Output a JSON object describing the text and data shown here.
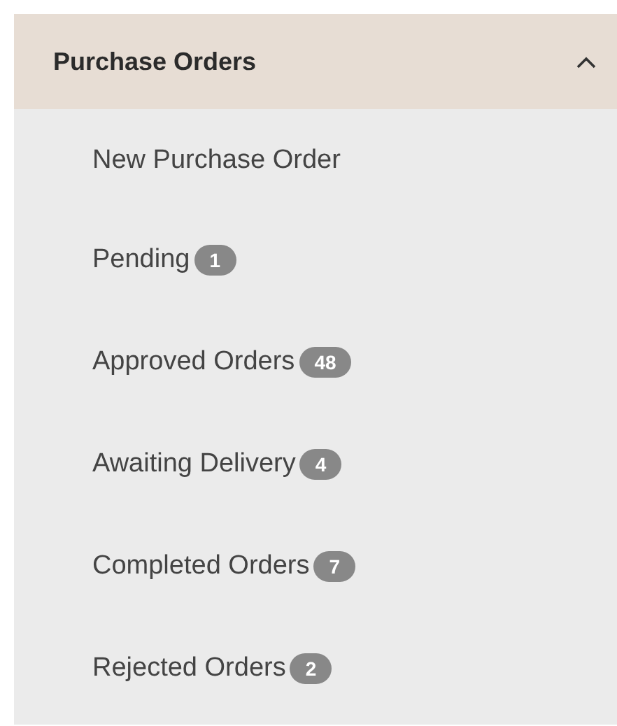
{
  "section": {
    "title": "Purchase Orders",
    "expanded": true,
    "items": [
      {
        "label": "New Purchase Order"
      },
      {
        "label": "Pending",
        "badge": "1"
      },
      {
        "label": "Approved Orders",
        "badge": "48"
      },
      {
        "label": "Awaiting Delivery",
        "badge": "4"
      },
      {
        "label": "Completed Orders",
        "badge": "7"
      },
      {
        "label": "Rejected Orders",
        "badge": "2"
      }
    ]
  }
}
